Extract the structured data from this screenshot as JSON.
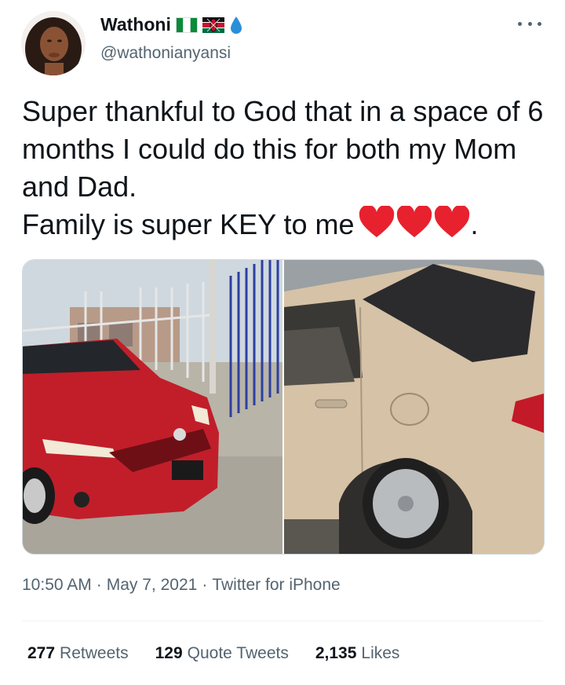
{
  "author": {
    "display_name": "Wathoni",
    "handle": "@wathonianyansi",
    "flags": [
      "nigeria-flag",
      "kenya-flag"
    ],
    "extra_icon": "water-drop-icon"
  },
  "tweet": {
    "line1": "Super thankful to God that in a space of 6 months I could do this for both my Mom and Dad.",
    "line2": "Family is super KEY to me",
    "line2_end": ".",
    "emoji": [
      "red-heart-icon",
      "red-heart-icon",
      "red-heart-icon"
    ]
  },
  "media": {
    "photos": [
      "red-toyota-corolla-photo",
      "gold-toyota-corolla-photo"
    ]
  },
  "meta": {
    "time": "10:50 AM",
    "sep": "·",
    "date": "May 7, 2021",
    "source": "Twitter for iPhone"
  },
  "stats": {
    "retweets_count": "277",
    "retweets_label": "Retweets",
    "quotes_count": "129",
    "quotes_label": "Quote Tweets",
    "likes_count": "2,135",
    "likes_label": "Likes"
  },
  "colors": {
    "text": "#0f1419",
    "secondary": "#536471",
    "heart": "#e8212e",
    "border": "#cfd9de"
  }
}
